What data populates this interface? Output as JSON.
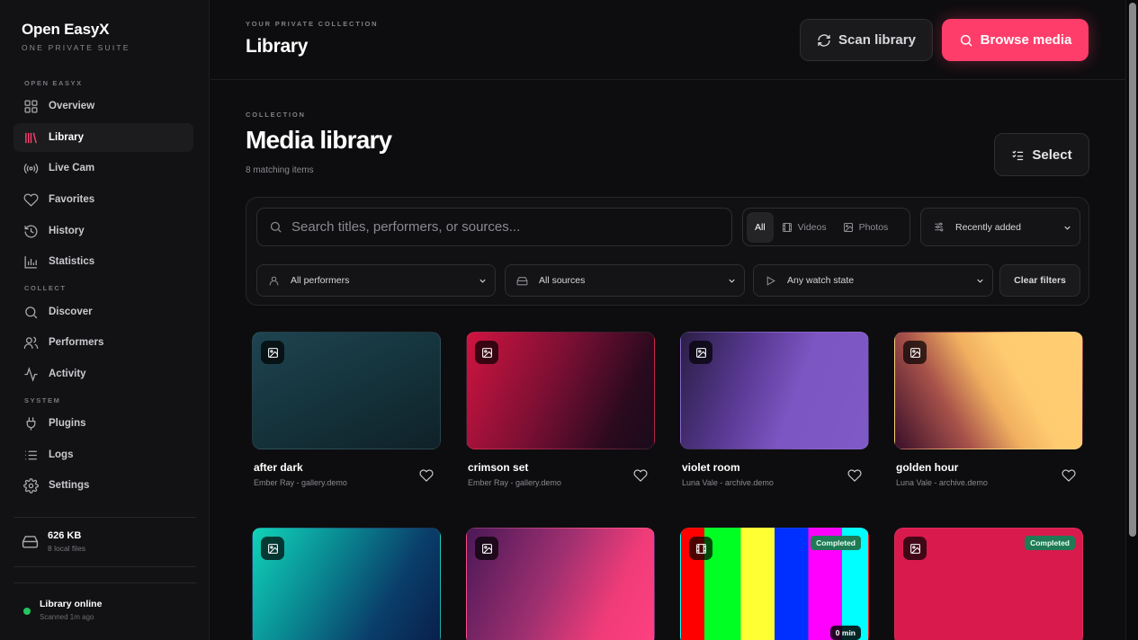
{
  "brand": {
    "name": "Open EasyX",
    "tagline": "ONE PRIVATE SUITE"
  },
  "sidebar": {
    "sections": [
      {
        "label": "OPEN EASYX",
        "items": [
          {
            "label": "Overview",
            "icon": "grid-icon",
            "active": false
          },
          {
            "label": "Library",
            "icon": "library-icon",
            "active": true
          },
          {
            "label": "Live Cam",
            "icon": "broadcast-icon",
            "active": false
          },
          {
            "label": "Favorites",
            "icon": "heart-icon",
            "active": false
          },
          {
            "label": "History",
            "icon": "history-icon",
            "active": false
          },
          {
            "label": "Statistics",
            "icon": "bar-chart-icon",
            "active": false
          }
        ]
      },
      {
        "label": "COLLECT",
        "items": [
          {
            "label": "Discover",
            "icon": "search-icon",
            "active": false
          },
          {
            "label": "Performers",
            "icon": "users-icon",
            "active": false
          },
          {
            "label": "Activity",
            "icon": "activity-icon",
            "active": false
          }
        ]
      },
      {
        "label": "SYSTEM",
        "items": [
          {
            "label": "Plugins",
            "icon": "plug-icon",
            "active": false
          },
          {
            "label": "Logs",
            "icon": "list-icon",
            "active": false
          },
          {
            "label": "Settings",
            "icon": "gear-icon",
            "active": false
          }
        ]
      }
    ],
    "storage": {
      "size": "626 KB",
      "files": "8 local files"
    },
    "status": {
      "title": "Library online",
      "subtitle": "Scanned 1m ago"
    }
  },
  "topbar": {
    "eyebrow": "YOUR PRIVATE COLLECTION",
    "title": "Library",
    "scan_label": "Scan library",
    "browse_label": "Browse media"
  },
  "main": {
    "eyebrow": "COLLECTION",
    "title": "Media library",
    "count": "8 matching items",
    "select_label": "Select"
  },
  "filters": {
    "search_placeholder": "Search titles, performers, or sources...",
    "segments": [
      "All",
      "Videos",
      "Photos"
    ],
    "active_segment": "All",
    "sort": "Recently added",
    "performer": "All performers",
    "source": "All sources",
    "watch_state": "Any watch state",
    "clear_label": "Clear filters"
  },
  "media": [
    {
      "title": "after dark",
      "subtitle": "Ember Ray - gallery.demo",
      "type": "photo",
      "badge": "",
      "duration": ""
    },
    {
      "title": "crimson set",
      "subtitle": "Ember Ray - gallery.demo",
      "type": "photo",
      "badge": "",
      "duration": ""
    },
    {
      "title": "violet room",
      "subtitle": "Luna Vale - archive.demo",
      "type": "photo",
      "badge": "",
      "duration": ""
    },
    {
      "title": "golden hour",
      "subtitle": "Luna Vale - archive.demo",
      "type": "photo",
      "badge": "",
      "duration": ""
    },
    {
      "title": "",
      "subtitle": "",
      "type": "photo",
      "badge": "",
      "duration": ""
    },
    {
      "title": "",
      "subtitle": "",
      "type": "photo",
      "badge": "",
      "duration": ""
    },
    {
      "title": "",
      "subtitle": "",
      "type": "video",
      "badge": "Completed",
      "duration": "0 min"
    },
    {
      "title": "",
      "subtitle": "",
      "type": "photo",
      "badge": "Completed",
      "duration": ""
    }
  ],
  "colors": {
    "accent": "#ff3d6a",
    "status_online": "#22c55e",
    "badge_completed": "#1f7a55"
  }
}
